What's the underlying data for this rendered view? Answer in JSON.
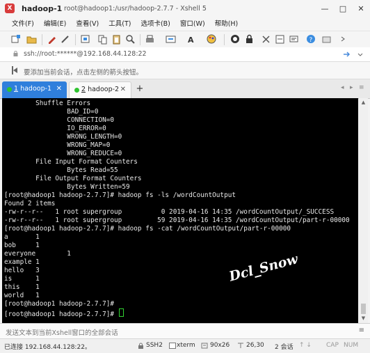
{
  "window": {
    "session_name": "hadoop-1",
    "title_path": "root@hadoop1:/usr/hadoop-2.7.7 - Xshell 5",
    "controls": [
      "—",
      "□",
      "✕"
    ]
  },
  "menu": [
    "文件(F)",
    "编辑(E)",
    "查看(V)",
    "工具(T)",
    "选项卡(B)",
    "窗口(W)",
    "帮助(H)"
  ],
  "address": {
    "text": "ssh://root:******@192.168.44.128:22"
  },
  "hint": {
    "text": "要添加当前会话，点击左侧的箭头按钮。"
  },
  "tabs": [
    {
      "num": "1",
      "name": "hadoop-1",
      "close": "✕"
    },
    {
      "num": "2",
      "name": "hadoop-2",
      "close": "✕"
    }
  ],
  "tab_add": "+",
  "tab_nav": [
    "◂",
    "▸",
    "≡"
  ],
  "terminal": {
    "lines": [
      "        Shuffle Errors",
      "                BAD_ID=0",
      "                CONNECTION=0",
      "                IO_ERROR=0",
      "                WRONG_LENGTH=0",
      "                WRONG_MAP=0",
      "                WRONG_REDUCE=0",
      "        File Input Format Counters",
      "                Bytes Read=55",
      "        File Output Format Counters",
      "                Bytes Written=59",
      "[root@hadoop1 hadoop-2.7.7]# hadoop fs -ls /wordCountOutput",
      "Found 2 items",
      "-rw-r--r--   1 root supergroup          0 2019-04-16 14:35 /wordCountOutput/_SUCCESS",
      "-rw-r--r--   1 root supergroup         59 2019-04-16 14:35 /wordCountOutput/part-r-00000",
      "[root@hadoop1 hadoop-2.7.7]# hadoop fs -cat /wordCountOutput/part-r-00000",
      "a       1",
      "bob     1",
      "everyone        1",
      "example 1",
      "hello   3",
      "is      1",
      "this    1",
      "world   1",
      "[root@hadoop1 hadoop-2.7.7]#",
      "[root@hadoop1 hadoop-2.7.7]# "
    ],
    "watermark": "Dcl_Snow",
    "cursor_color": "#31d331"
  },
  "compose": {
    "placeholder": "发送文本到当前Xshell窗口的全部会话",
    "menu_glyph": "≡"
  },
  "status": {
    "connection": "已连接 192.168.44.128:22。",
    "protocol": "SSH2",
    "terminal_type": "xterm",
    "size": "90x26",
    "cursor_pos": "26,30",
    "sessions": "2 会话",
    "caps": "CAP",
    "num": "NUM"
  },
  "colors": {
    "active_tab": "#2f7fdc",
    "terminal_bg": "#000000",
    "terminal_fg": "#e8e8e8",
    "app_red": "#d83b3b"
  },
  "icons": {
    "toolbar": [
      "new-session-icon",
      "open-folder-icon",
      "properties-icon",
      "disconnect-icon",
      "reconnect-icon",
      "copy-icon",
      "paste-icon",
      "find-icon",
      "print-icon",
      "transfer-icon",
      "font-icon",
      "color-scheme-icon",
      "fullscreen-icon",
      "lock-icon",
      "script-icon",
      "xftp-icon",
      "compose-icon",
      "help-icon"
    ]
  }
}
